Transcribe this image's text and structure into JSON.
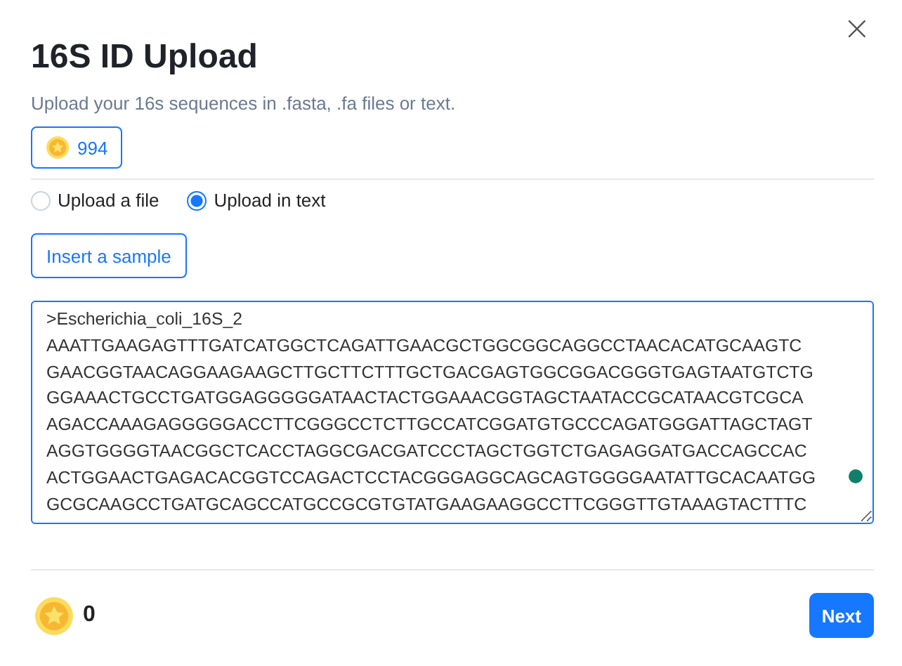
{
  "dialog": {
    "title": "16S ID Upload",
    "subtitle": "Upload your 16s sequences in .fasta, .fa files or text.",
    "close": "×"
  },
  "credits_badge": {
    "value": "994"
  },
  "upload_modes": [
    {
      "label": "Upload a file",
      "selected": false
    },
    {
      "label": "Upload in text",
      "selected": true
    }
  ],
  "insert_sample_button": "Insert a sample",
  "sequence_input": {
    "value": ">Escherichia_coli_16S_2\nAAATTGAAGAGTTTGATCATGGCTCAGATTGAACGCTGGCGGCAGGCCTAACACATGCAAGTC\nGAACGGTAACAGGAAGAAGCTTGCTTCTTTGCTGACGAGTGGCGGACGGGTGAGTAATGTCTG\nGGAAACTGCCTGATGGAGGGGGATAACTACTGGAAACGGTAGCTAATACCGCATAACGTCGCA\nAGACCAAAGAGGGGGACCTTCGGGCCTCTTGCCATCGGATGTGCCCAGATGGGATTAGCTAGT\nAGGTGGGGTAACGGCTCACCTAGGCGACGATCCCTAGCTGGTCTGAGAGGATGACCAGCCAC\nACTGGAACTGAGACACGGTCCAGACTCCTACGGGAGGCAGCAGTGGGGAATATTGCACAATGG\nGCGCAAGCCTGATGCAGCCATGCCGCGTGTATGAAGAAGGCCTTCGGGTTGTAAAGTACTTTC"
  },
  "footer": {
    "cost": "0",
    "next_button": "Next"
  }
}
